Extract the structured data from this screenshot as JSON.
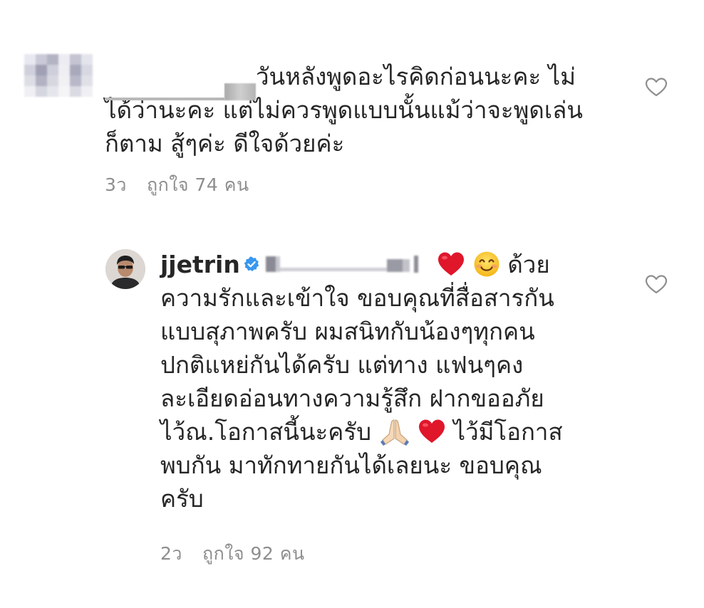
{
  "comments": [
    {
      "username_obscured": true,
      "text_line1": "วันหลังพูดอะไรคิดก่อนนะคะ ไม่",
      "text_line2": "ได้ว่านะคะ แต่ไม่ควรพูดแบบนั้นแม้ว่าจะพูดเล่น",
      "text_line3": "ก็ตาม สู้ๆค่ะ ดีใจด้วยค่ะ",
      "time": "3ว",
      "likes": "ถูกใจ 74 คน",
      "like_icon": "heart-outline-icon"
    },
    {
      "username": "jjetrin",
      "verified_icon": "verified-badge-icon",
      "mention_obscured": true,
      "text_line1_tail": "ด้วย",
      "text_line2": "ความรักและเข้าใจ ขอบคุณที่สื่อสารกัน",
      "text_line3": "แบบสุภาพครับ ผมสนิทกับน้องๆทุกคน",
      "text_line4": "ปกติแหย่กันได้ครับ แต่ทาง แฟนๆคง",
      "text_line5": "ละเอียดอ่อนทางความรู้สึก ฝากขออภัย",
      "text_line6_a": "ไว้ณ.โอกาสนี้นะครับ",
      "text_line6_b": "ไว้มีโอกาส",
      "text_line7": "พบกัน มาทักทายกันได้เลยนะ ขอบคุณ",
      "text_line8": "ครับ",
      "time": "2ว",
      "likes": "ถูกใจ 92 คน",
      "like_icon": "heart-outline-icon"
    }
  ],
  "colors": {
    "text": "#262626",
    "meta": "#8e8e8e",
    "verified": "#3897f0",
    "heart_red": "#e0162b"
  }
}
